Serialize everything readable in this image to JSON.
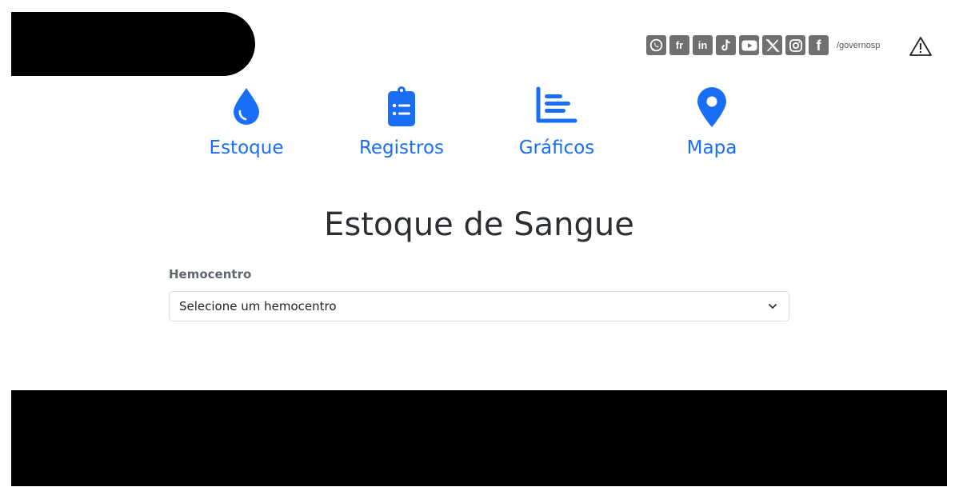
{
  "header": {
    "social": {
      "handle": "/governosp",
      "icons": [
        {
          "name": "whatsapp-icon",
          "glyph": ""
        },
        {
          "name": "flickr-icon",
          "glyph": "fr"
        },
        {
          "name": "linkedin-icon",
          "glyph": "in"
        },
        {
          "name": "tiktok-icon",
          "glyph": ""
        },
        {
          "name": "youtube-icon",
          "glyph": ""
        },
        {
          "name": "x-twitter-icon",
          "glyph": "𝕏"
        },
        {
          "name": "instagram-icon",
          "glyph": ""
        },
        {
          "name": "facebook-icon",
          "glyph": "f"
        }
      ]
    },
    "alert_icon": "warning-icon"
  },
  "nav": {
    "items": [
      {
        "label": "Estoque",
        "icon": "blood-drop-icon"
      },
      {
        "label": "Registros",
        "icon": "clipboard-list-icon"
      },
      {
        "label": "Gráficos",
        "icon": "bar-chart-icon"
      },
      {
        "label": "Mapa",
        "icon": "map-pin-icon"
      }
    ]
  },
  "main": {
    "title": "Estoque de Sangue",
    "hemocentro_label": "Hemocentro",
    "hemocentro_select": "Selecione um hemocentro"
  },
  "colors": {
    "accent": "#1a6ef5",
    "social_icon_bg": "#707070",
    "title_text": "#2b2f33"
  }
}
